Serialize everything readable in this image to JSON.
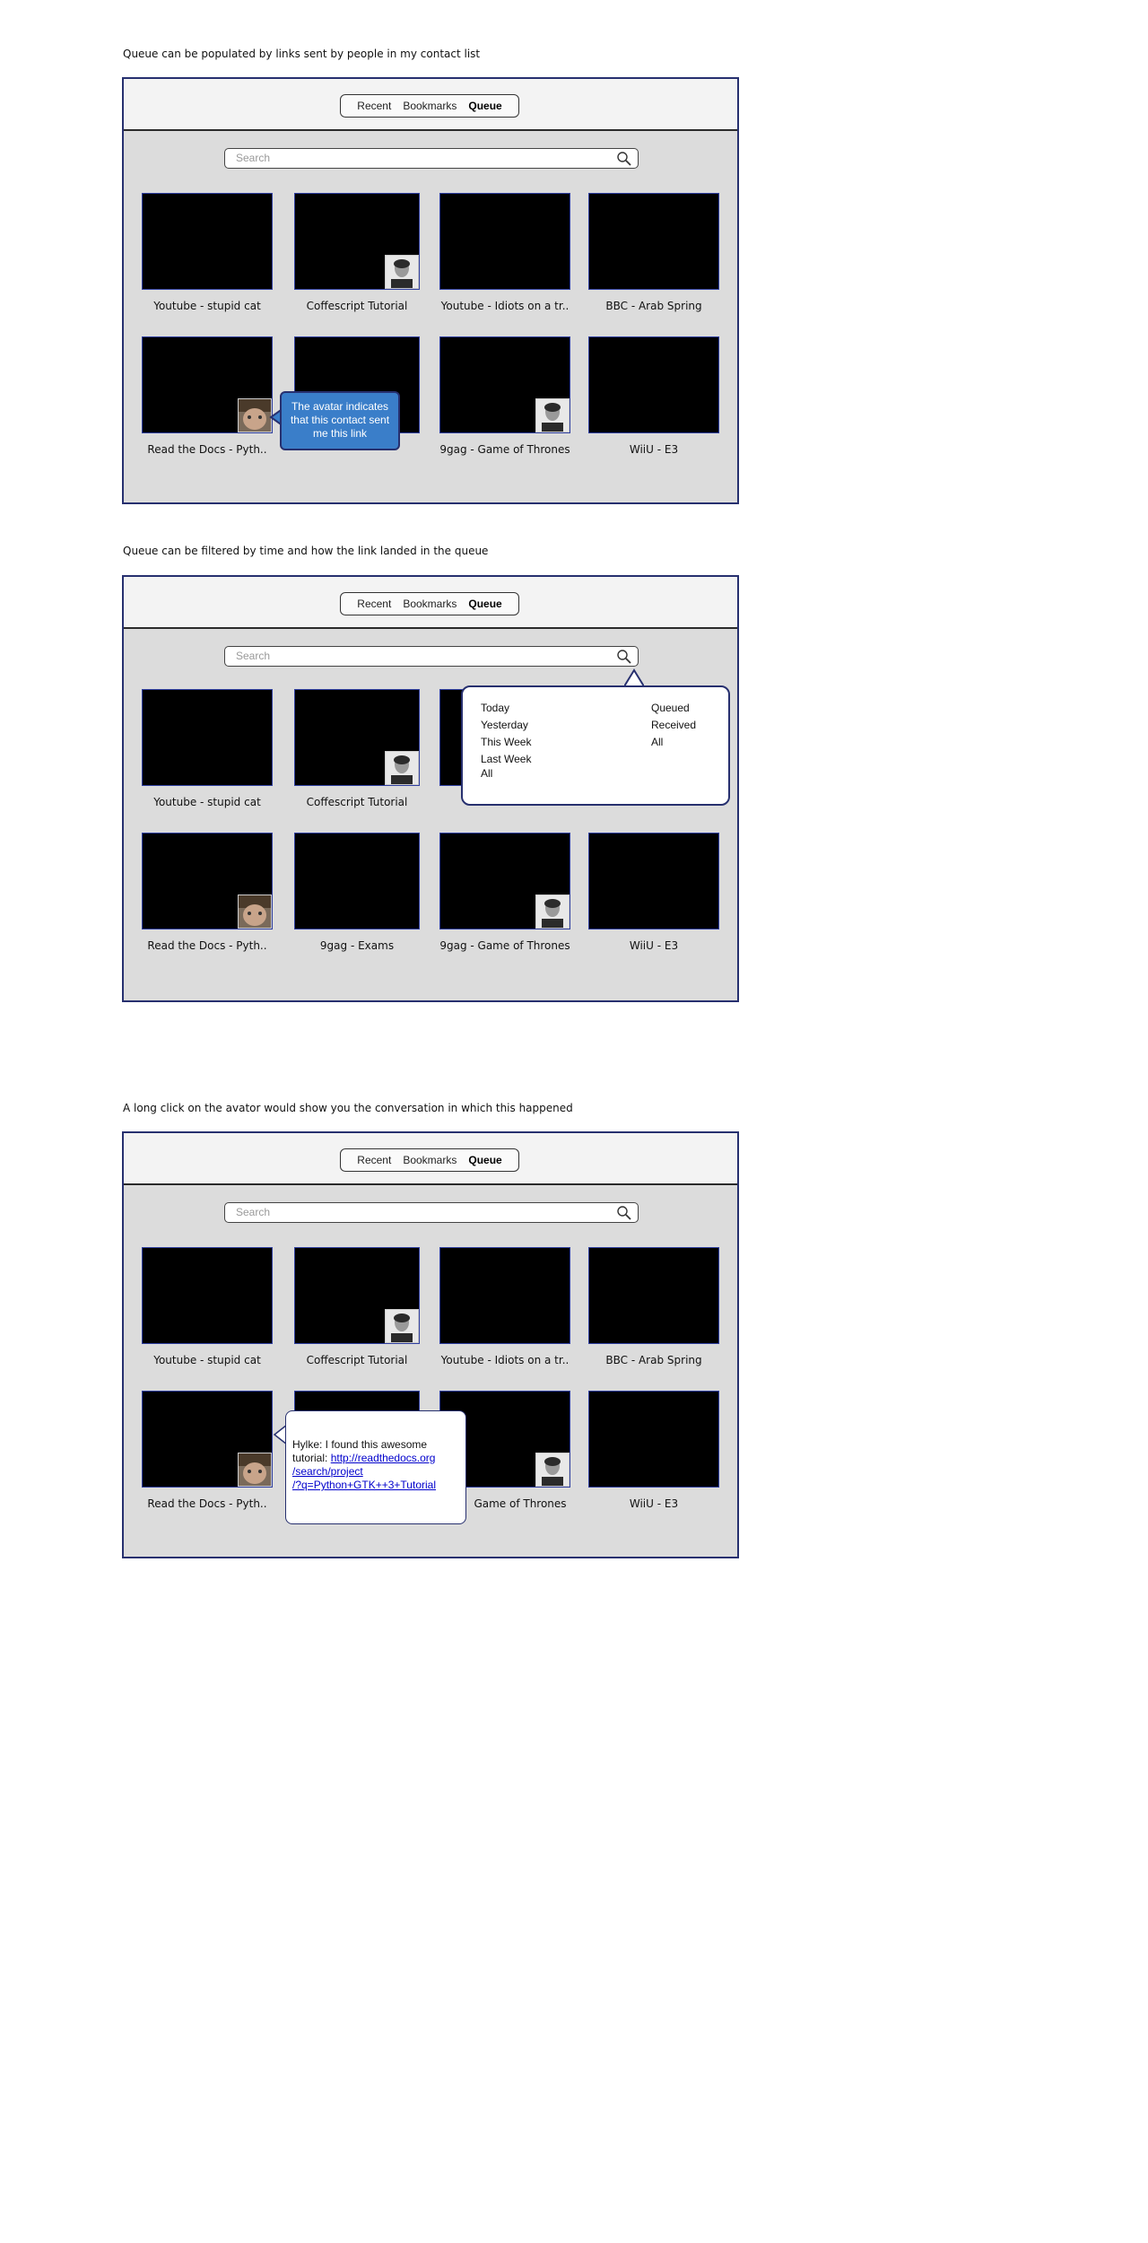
{
  "captions": [
    "Queue can be populated by links sent by people in my contact list",
    "Queue can be filtered by time and how the link landed in the queue",
    "A long click on the avator would show you the conversation in which this happened"
  ],
  "tabs": [
    "Recent",
    "Bookmarks",
    "Queue"
  ],
  "search": {
    "placeholder": "Search"
  },
  "panel1_labels": [
    "Youtube - stupid cat",
    "Coffescript Tutorial",
    "Youtube - Idiots on a tr..",
    "BBC - Arab Spring",
    "Read the Docs - Pyth..",
    "",
    "9gag - Game of Thrones",
    "WiiU - E3"
  ],
  "panel2_labels": [
    "Youtube - stupid cat",
    "Coffescript Tutorial",
    "Read the Docs - Pyth..",
    "9gag - Exams",
    "9gag - Game of Thrones",
    "WiiU - E3"
  ],
  "panel3_labels": [
    "Youtube - stupid cat",
    "Coffescript Tutorial",
    "Youtube - Idiots on a tr..",
    "BBC - Arab Spring",
    "Read the Docs - Pyth..",
    "Game of Thrones",
    "WiiU - E3"
  ],
  "callout1": "The avatar indicates that this contact sent me this link",
  "filter": {
    "time_options": [
      "Today",
      "Yesterday",
      "This Week",
      "Last Week",
      "All"
    ],
    "source_options": [
      "Queued",
      "Received",
      "All"
    ]
  },
  "chat": {
    "text": "Hylke: I found this awesome tutorial:",
    "link": "http://readthedocs.org/search/project/?q=Python+GTK++3+Tutorial",
    "link_lines": [
      "http://readthedocs.org",
      "/search/project",
      "/?q=Python+GTK++3+Tutorial"
    ]
  }
}
